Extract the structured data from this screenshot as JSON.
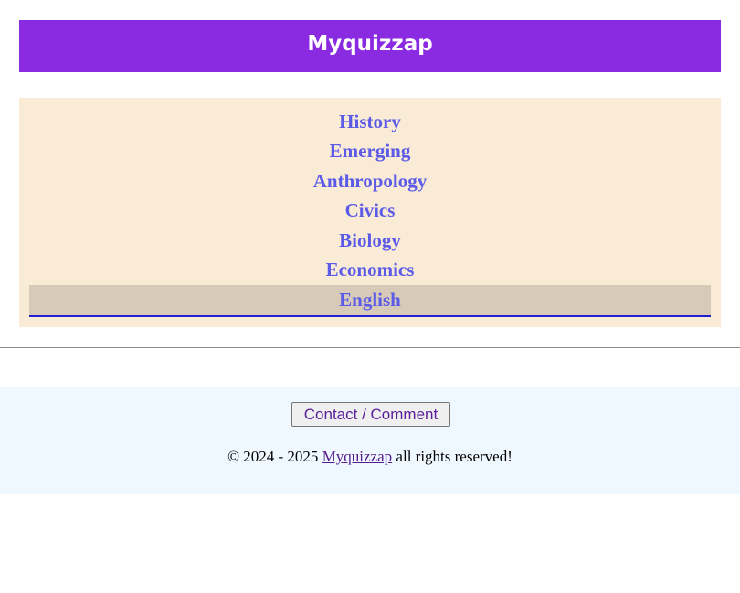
{
  "header": {
    "title": "Myquizzap"
  },
  "menu": {
    "items": [
      {
        "label": "History"
      },
      {
        "label": "Emerging"
      },
      {
        "label": "Anthropology"
      },
      {
        "label": "Civics"
      },
      {
        "label": "Biology"
      },
      {
        "label": "Economics"
      },
      {
        "label": "English"
      }
    ],
    "active_item": "English"
  },
  "footer": {
    "contact_button_label": "Contact / Comment",
    "copyright_prefix": "© 2024 - 2025",
    "site_link": "Myquizzap",
    "copyright_suffix": "all rights reserved!"
  },
  "colors": {
    "header_bg": "#8a2be2",
    "menu_bg": "#faebd7",
    "menu_text": "#5b5be8",
    "active_bg": "#d8cab8",
    "footer_bg": "#f0f8ff"
  }
}
